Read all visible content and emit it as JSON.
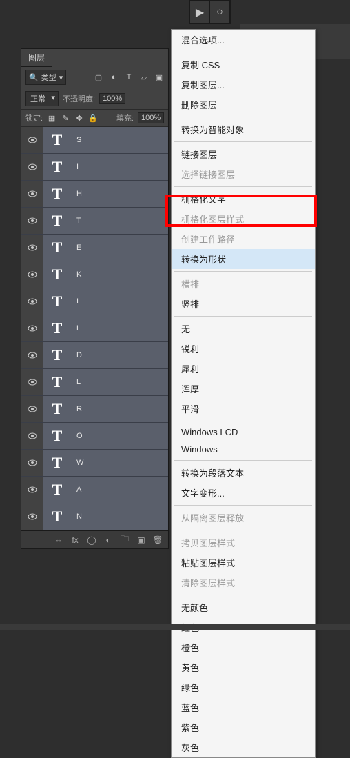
{
  "toolbar": {
    "play": "▶",
    "lasso": "○"
  },
  "panel": {
    "tab": "图层",
    "filter_label": "类型",
    "blend_mode": "正常",
    "opacity_label": "不透明度:",
    "opacity_value": "100%",
    "lock_label": "锁定:",
    "fill_label": "填充:",
    "fill_value": "100%"
  },
  "layers": [
    {
      "name": "S"
    },
    {
      "name": "I"
    },
    {
      "name": "H"
    },
    {
      "name": "T"
    },
    {
      "name": "E"
    },
    {
      "name": "K"
    },
    {
      "name": "I"
    },
    {
      "name": "L"
    },
    {
      "name": "D"
    },
    {
      "name": "L"
    },
    {
      "name": "R"
    },
    {
      "name": "O"
    },
    {
      "name": "W"
    },
    {
      "name": "A"
    },
    {
      "name": "N"
    }
  ],
  "menu": {
    "blend_options": "混合选项...",
    "copy_css": "复制 CSS",
    "duplicate_layer": "复制图层...",
    "delete_layer": "删除图层",
    "convert_smart": "转换为智能对象",
    "link_layers": "链接图层",
    "select_linked": "选择链接图层",
    "rasterize_type": "栅格化文字",
    "rasterize_style": "栅格化图层样式",
    "create_work_path": "创建工作路径",
    "convert_to_shape": "转换为形状",
    "horizontal": "横排",
    "vertical": "竖排",
    "none": "无",
    "sharp": "锐利",
    "crisp": "犀利",
    "strong": "浑厚",
    "smooth": "平滑",
    "windows_lcd": "Windows LCD",
    "windows": "Windows",
    "convert_paragraph": "转换为段落文本",
    "warp_text": "文字变形...",
    "release_iso": "从隔离图层释放",
    "copy_style": "拷贝图层样式",
    "paste_style": "粘贴图层样式",
    "clear_style": "清除图层样式",
    "no_color": "无颜色",
    "red": "红色",
    "orange": "橙色",
    "yellow": "黄色",
    "green": "绿色",
    "blue": "蓝色",
    "purple": "紫色",
    "gray": "灰色"
  }
}
